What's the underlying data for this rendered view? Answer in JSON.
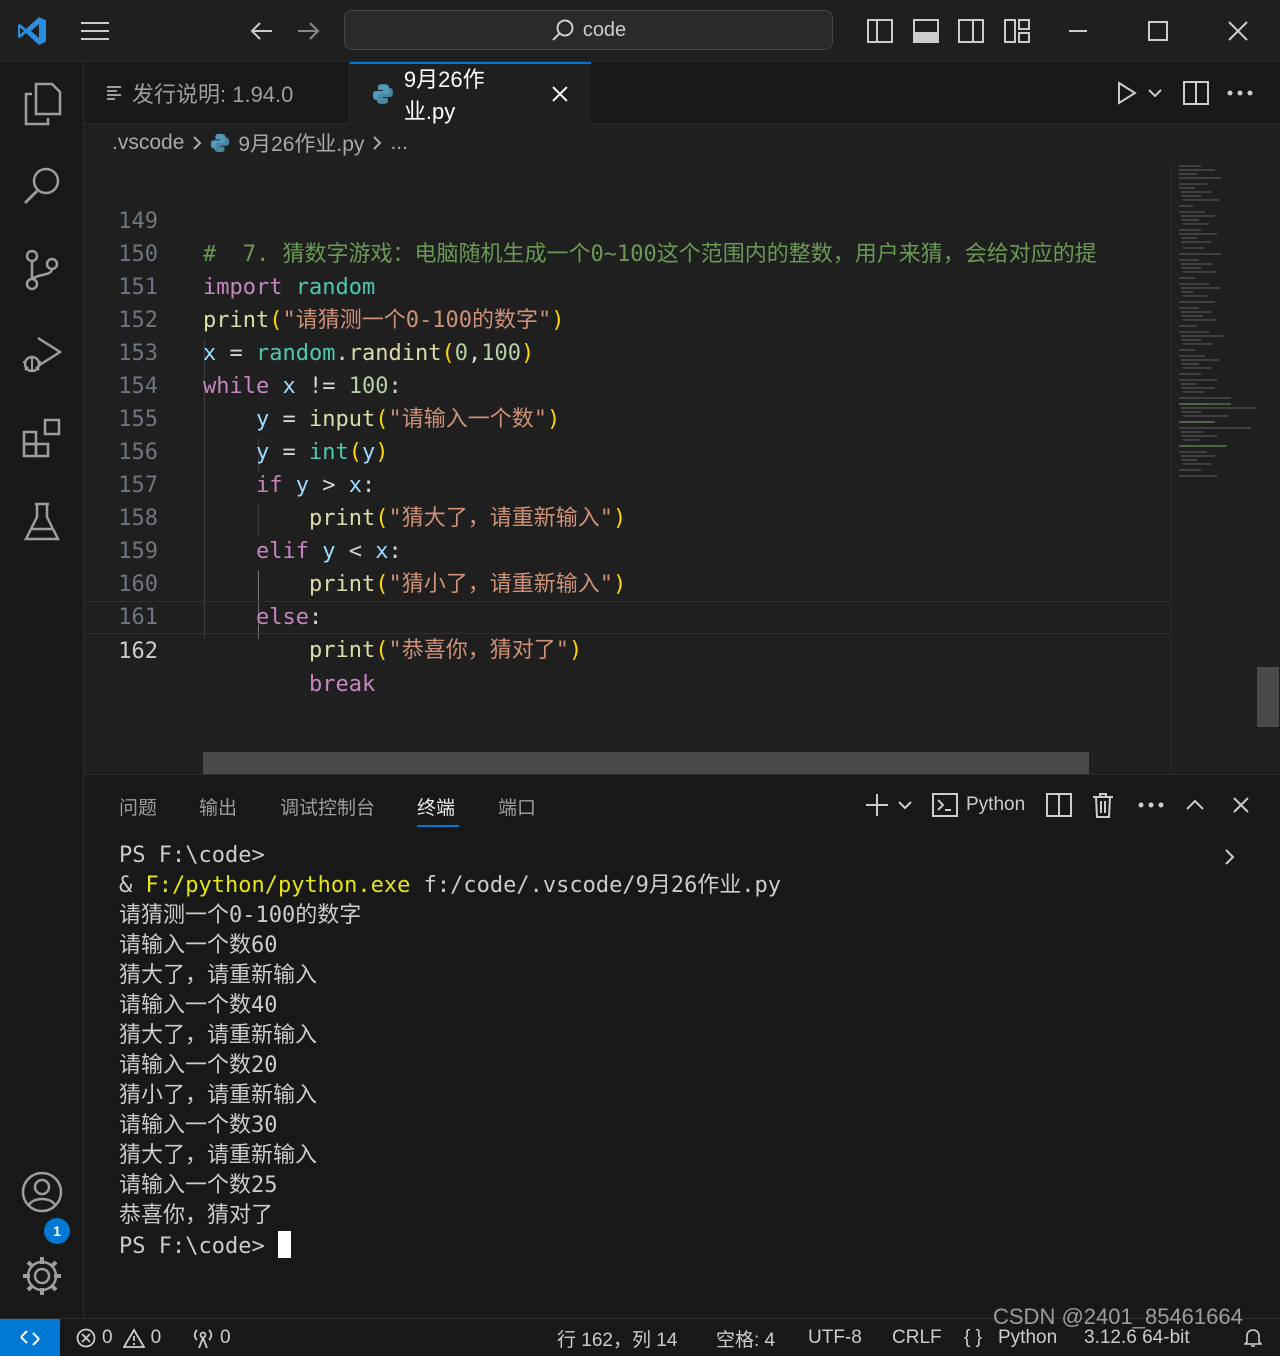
{
  "titlebar": {
    "search_text": "code"
  },
  "tabs": [
    {
      "label": "发行说明: 1.94.0",
      "active": false
    },
    {
      "label": "9月26作业.py",
      "active": true
    }
  ],
  "breadcrumb": {
    "folder": ".vscode",
    "file": "9月26作业.py",
    "more": "..."
  },
  "editor": {
    "lines": [
      {
        "num": "149",
        "text": "#  7. 猜数字游戏：电脑随机生成一个0~100这个范围内的整数，用户来猜，会给对应的提"
      },
      {
        "num": "150",
        "text": "import random"
      },
      {
        "num": "151",
        "text": "print(\"请猜测一个0-100的数字\")"
      },
      {
        "num": "152",
        "text": "x = random.randint(0,100)"
      },
      {
        "num": "153",
        "text": "while x != 100:"
      },
      {
        "num": "154",
        "text": "    y = input(\"请输入一个数\")"
      },
      {
        "num": "155",
        "text": "    y = int(y)"
      },
      {
        "num": "156",
        "text": "    if y > x:"
      },
      {
        "num": "157",
        "text": "        print(\"猜大了，请重新输入\")"
      },
      {
        "num": "158",
        "text": "    elif y < x:"
      },
      {
        "num": "159",
        "text": "        print(\"猜小了，请重新输入\")"
      },
      {
        "num": "160",
        "text": "    else:"
      },
      {
        "num": "161",
        "text": "        print(\"恭喜你，猜对了\")"
      },
      {
        "num": "162",
        "text": "        break"
      }
    ]
  },
  "panel": {
    "tabs": [
      "问题",
      "输出",
      "调试控制台",
      "终端",
      "端口"
    ],
    "active_tab": "终端",
    "shell_label": "Python",
    "terminal_lines": [
      "PS F:\\code>",
      "& F:/python/python.exe f:/code/.vscode/9月26作业.py",
      "请猜测一个0-100的数字",
      "请输入一个数60",
      "猜大了，请重新输入",
      "请输入一个数40",
      "猜大了，请重新输入",
      "请输入一个数20",
      "猜小了，请重新输入",
      "请输入一个数30",
      "猜大了，请重新输入",
      "请输入一个数25",
      "恭喜你，猜对了",
      "PS F:\\code>"
    ],
    "exe_path": "F:/python/python.exe",
    "script_arg": " f:/code/.vscode/9月26作业.py"
  },
  "statusbar": {
    "errors": "0",
    "warnings": "0",
    "ports": "0",
    "position": "行 162，列 14",
    "spaces": "空格: 4",
    "encoding": "UTF-8",
    "eol": "CRLF",
    "language": "Python",
    "interpreter": "3.12.6 64-bit",
    "watermark": "CSDN @2401_85461664"
  },
  "badges": {
    "settings_count": "1"
  },
  "colors": {
    "accent": "#0078d4",
    "background": "#1f1f1f",
    "keyword": "#c586c0",
    "string": "#ce9178",
    "function": "#dcdcaa"
  }
}
